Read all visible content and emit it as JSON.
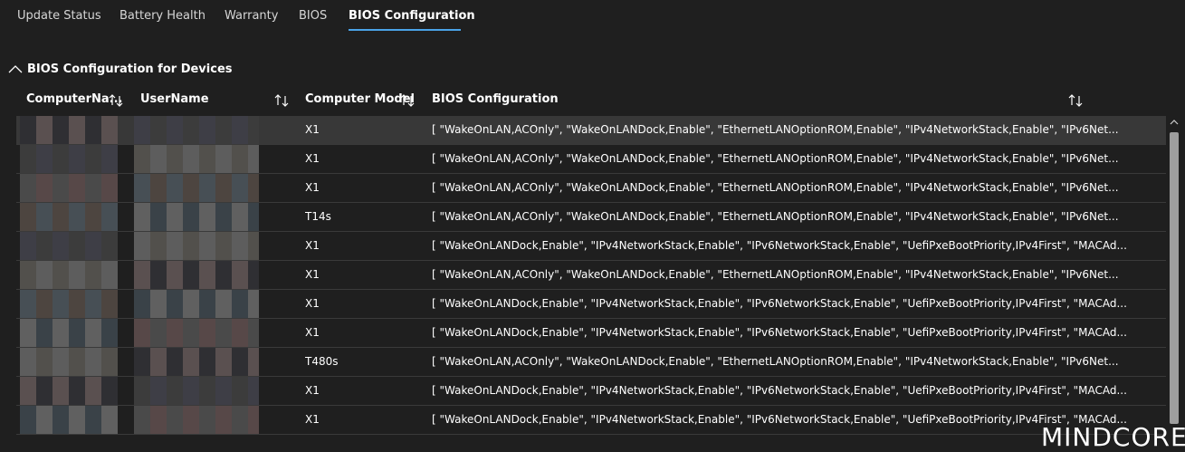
{
  "tabs": [
    {
      "label": "Update Status"
    },
    {
      "label": "Battery Health"
    },
    {
      "label": "Warranty"
    },
    {
      "label": "BIOS"
    },
    {
      "label": "BIOS Configuration"
    }
  ],
  "active_tab_index": 4,
  "section": {
    "title": "BIOS Configuration for Devices",
    "icon": "chevron-up-icon",
    "expanded": true
  },
  "columns": [
    {
      "label": "ComputerNa...",
      "sort_icon": "sort-icon"
    },
    {
      "label": "UserName",
      "sort_icon": "sort-icon"
    },
    {
      "label": "Computer Model",
      "sort_icon": "sort-icon"
    },
    {
      "label": "BIOS Configuration",
      "sort_icon": "sort-icon"
    }
  ],
  "rows": [
    {
      "computer_model": "X1",
      "bios_configuration": "[ \"WakeOnLAN,ACOnly\", \"WakeOnLANDock,Enable\", \"EthernetLANOptionROM,Enable\", \"IPv4NetworkStack,Enable\", \"IPv6Net...",
      "selected": true
    },
    {
      "computer_model": "X1",
      "bios_configuration": "[ \"WakeOnLAN,ACOnly\", \"WakeOnLANDock,Enable\", \"EthernetLANOptionROM,Enable\", \"IPv4NetworkStack,Enable\", \"IPv6Net..."
    },
    {
      "computer_model": "X1",
      "bios_configuration": "[ \"WakeOnLAN,ACOnly\", \"WakeOnLANDock,Enable\", \"EthernetLANOptionROM,Enable\", \"IPv4NetworkStack,Enable\", \"IPv6Net..."
    },
    {
      "computer_model": "T14s",
      "bios_configuration": "[ \"WakeOnLAN,ACOnly\", \"WakeOnLANDock,Enable\", \"EthernetLANOptionROM,Enable\", \"IPv4NetworkStack,Enable\", \"IPv6Net..."
    },
    {
      "computer_model": "X1",
      "bios_configuration": "[ \"WakeOnLANDock,Enable\", \"IPv4NetworkStack,Enable\", \"IPv6NetworkStack,Enable\", \"UefiPxeBootPriority,IPv4First\", \"MACAd..."
    },
    {
      "computer_model": "X1",
      "bios_configuration": "[ \"WakeOnLAN,ACOnly\", \"WakeOnLANDock,Enable\", \"EthernetLANOptionROM,Enable\", \"IPv4NetworkStack,Enable\", \"IPv6Net..."
    },
    {
      "computer_model": "X1",
      "bios_configuration": "[ \"WakeOnLANDock,Enable\", \"IPv4NetworkStack,Enable\", \"IPv6NetworkStack,Enable\", \"UefiPxeBootPriority,IPv4First\", \"MACAd..."
    },
    {
      "computer_model": "X1",
      "bios_configuration": "[ \"WakeOnLANDock,Enable\", \"IPv4NetworkStack,Enable\", \"IPv6NetworkStack,Enable\", \"UefiPxeBootPriority,IPv4First\", \"MACAd..."
    },
    {
      "computer_model": "T480s",
      "bios_configuration": "[ \"WakeOnLAN,ACOnly\", \"WakeOnLANDock,Enable\", \"EthernetLANOptionROM,Enable\", \"IPv4NetworkStack,Enable\", \"IPv6Net..."
    },
    {
      "computer_model": "X1",
      "bios_configuration": "[ \"WakeOnLANDock,Enable\", \"IPv4NetworkStack,Enable\", \"IPv6NetworkStack,Enable\", \"UefiPxeBootPriority,IPv4First\", \"MACAd..."
    },
    {
      "computer_model": "X1",
      "bios_configuration": "[ \"WakeOnLANDock,Enable\", \"IPv4NetworkStack,Enable\", \"IPv6NetworkStack,Enable\", \"UefiPxeBootPriority,IPv4First\", \"MACAd..."
    }
  ],
  "colors": {
    "background": "#1f1f1f",
    "accent": "#4aa3e8",
    "selected_row": "#383838",
    "row_divider": "#3a3a3a"
  },
  "watermark": "MINDCORE"
}
